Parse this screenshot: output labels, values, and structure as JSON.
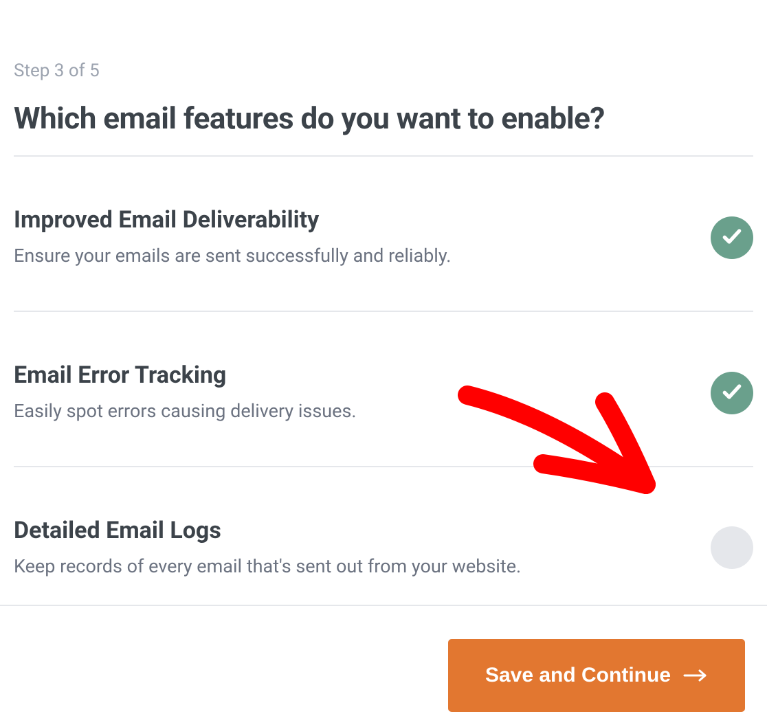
{
  "step_label": "Step 3 of 5",
  "page_title": "Which email features do you want to enable?",
  "features": [
    {
      "title": "Improved Email Deliverability",
      "desc": "Ensure your emails are sent successfully and reliably.",
      "checked": true
    },
    {
      "title": "Email Error Tracking",
      "desc": "Easily spot errors causing delivery issues.",
      "checked": true
    },
    {
      "title": "Detailed Email Logs",
      "desc": "Keep records of every email that's sent out from your website.",
      "checked": false
    }
  ],
  "footer": {
    "save_label": "Save and Continue"
  },
  "colors": {
    "accent": "#e27730",
    "toggle_on": "#6aa08c",
    "toggle_off": "#e5e7eb"
  }
}
